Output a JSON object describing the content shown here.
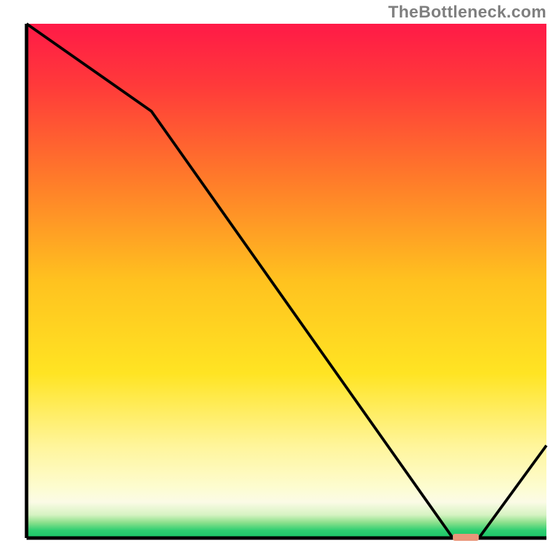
{
  "watermark": "TheBottleneck.com",
  "chart_data": {
    "type": "line",
    "title": "",
    "xlabel": "",
    "ylabel": "",
    "xlim": [
      0,
      100
    ],
    "ylim": [
      0,
      100
    ],
    "grid": false,
    "x": [
      0,
      24,
      82,
      87,
      100
    ],
    "values": [
      100,
      83,
      0,
      0,
      18
    ],
    "notes": "Single unlabeled line over a vertical red→green gradient background. Y=0 corresponds to the green bottom band (optimal / no bottleneck); Y=100 corresponds to the red top. A short flat highlighted segment sits at the trough around x≈82–87.",
    "highlight_segment": {
      "x_start": 82,
      "x_end": 87,
      "y": 0
    },
    "gradient_stops": [
      {
        "pct": 0,
        "color": "#ff1a47"
      },
      {
        "pct": 12,
        "color": "#ff3a3a"
      },
      {
        "pct": 30,
        "color": "#ff7a2a"
      },
      {
        "pct": 50,
        "color": "#ffc21f"
      },
      {
        "pct": 68,
        "color": "#ffe423"
      },
      {
        "pct": 82,
        "color": "#fff59a"
      },
      {
        "pct": 90,
        "color": "#fdfccf"
      },
      {
        "pct": 93,
        "color": "#fbfbe6"
      },
      {
        "pct": 95.5,
        "color": "#d6f3c2"
      },
      {
        "pct": 97,
        "color": "#8be08c"
      },
      {
        "pct": 98.5,
        "color": "#2fcf72"
      },
      {
        "pct": 100,
        "color": "#19c667"
      }
    ],
    "axis_color": "#000000",
    "line_color": "#000000",
    "highlight_color": "#e9967a"
  }
}
